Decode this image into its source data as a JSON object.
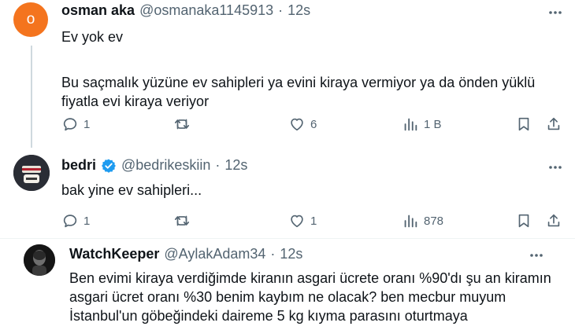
{
  "tweets": [
    {
      "avatar_letter": "o",
      "name": "osman aka",
      "handle": "@osmanaka1145913",
      "dot": "·",
      "time": "12s",
      "text_lines": [
        "Ev yok ev",
        "",
        "Bu saçmalık yüzüne ev sahipleri ya evini kiraya vermiyor ya da önden yüklü",
        "fiyatla evi kiraya veriyor"
      ],
      "replies": "1",
      "retweets": "",
      "likes": "6",
      "views": "1 B"
    },
    {
      "name": "bedri",
      "handle": "@bedrikeskiin",
      "dot": "·",
      "time": "12s",
      "text_lines": [
        "bak yine ev sahipleri..."
      ],
      "replies": "1",
      "retweets": "",
      "likes": "1",
      "views": "878"
    },
    {
      "name": "WatchKeeper",
      "handle": "@AylakAdam34",
      "dot": "·",
      "time": "12s",
      "text_lines": [
        "Ben evimi kiraya verdiğimde kiranın asgari ücrete oranı %90'dı şu an kiramın",
        "asgari ücret oranı %30 benim kaybım ne olacak? ben mecbur muyum",
        "İstanbul'un göbeğindeki daireme 5 kg kıyma parasını oturtmaya"
      ]
    }
  ],
  "colors": {
    "accent": "#1d9bf0",
    "muted": "#536471",
    "orange_avatar": "#f4741e"
  },
  "icons": [
    "more-icon",
    "reply-icon",
    "retweet-icon",
    "like-icon",
    "views-icon",
    "bookmark-icon",
    "share-icon",
    "verified-icon"
  ]
}
